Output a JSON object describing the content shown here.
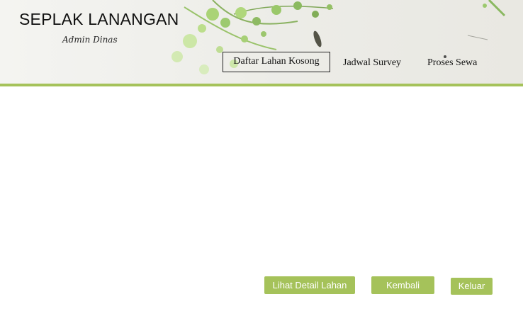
{
  "header": {
    "title": "SEPLAK LANANGAN",
    "subtitle": "Admin Dinas"
  },
  "nav": {
    "items": [
      {
        "label": "Daftar Lahan Kosong",
        "active": true
      },
      {
        "label": "Jadwal Survey",
        "active": false
      },
      {
        "label": "Proses Sewa",
        "active": false
      }
    ]
  },
  "actions": {
    "detail_label": "Lihat Detail Lahan",
    "back_label": "Kembali",
    "logout_label": "Keluar"
  },
  "colors": {
    "accent": "#a5c25a",
    "header_background": "#efefea"
  }
}
